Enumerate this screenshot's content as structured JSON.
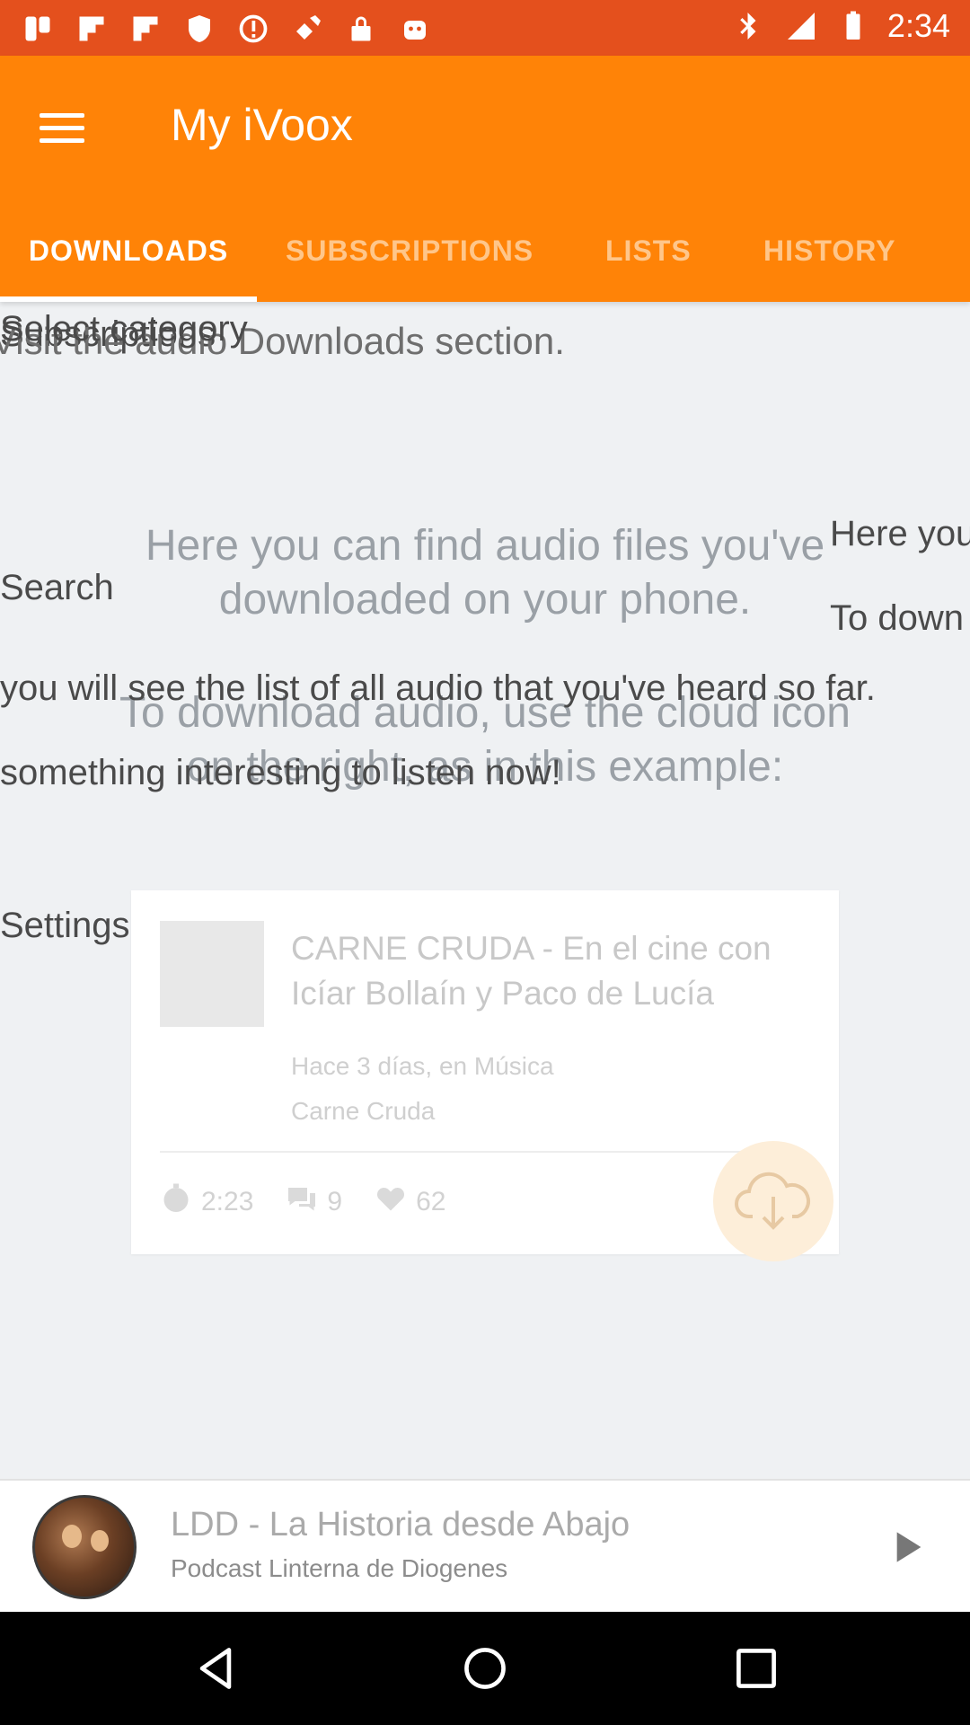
{
  "status_bar": {
    "time": "2:34",
    "icons": [
      "app-icon",
      "flipboard-icon",
      "flipboard-icon",
      "shield-icon",
      "info-icon",
      "satellite-icon",
      "lock-icon",
      "android-icon"
    ],
    "right_icons": [
      "bluetooth-icon"
    ]
  },
  "app_bar": {
    "title": "My iVoox",
    "menu_icon": "hamburger-menu-icon",
    "background": "#ff8307",
    "status_background": "#e4501d"
  },
  "tabs": [
    {
      "label": "DOWNLOADS",
      "active": true
    },
    {
      "label": "SUBSCRIPTIONS",
      "active": false
    },
    {
      "label": "LISTS",
      "active": false
    },
    {
      "label": "HISTORY",
      "active": false
    }
  ],
  "overlay_text": {
    "line_a": "Subscriptions",
    "line_b": "Visit the audio Downloads section.",
    "line_c": "Select category",
    "search": "Search",
    "here_you": "Here you",
    "to_down": "To down",
    "history_hint": "you will see the list of all audio that you've heard so far.",
    "interesting": "something interesting to listen now!",
    "settings": "Settings"
  },
  "downloads_help": {
    "intro": "Here you can find audio files you've downloaded on your phone.",
    "instruction": "To download audio, use the cloud icon on the right, as in this example:"
  },
  "example_card": {
    "title": "CARNE CRUDA - En el cine con Icíar Bollaín y Paco de Lucía",
    "meta_date": "Hace 3 días, en Música",
    "meta_author": "Carne Cruda",
    "duration": "2:23",
    "comments": "9",
    "likes": "62",
    "download_icon": "cloud-download-icon"
  },
  "player": {
    "title": "LDD - La Historia desde Abajo",
    "subtitle": "Podcast Linterna de Diogenes",
    "play_icon": "play-icon"
  },
  "nav_bar": {
    "icons": [
      "back-icon",
      "home-icon",
      "recents-icon"
    ]
  }
}
